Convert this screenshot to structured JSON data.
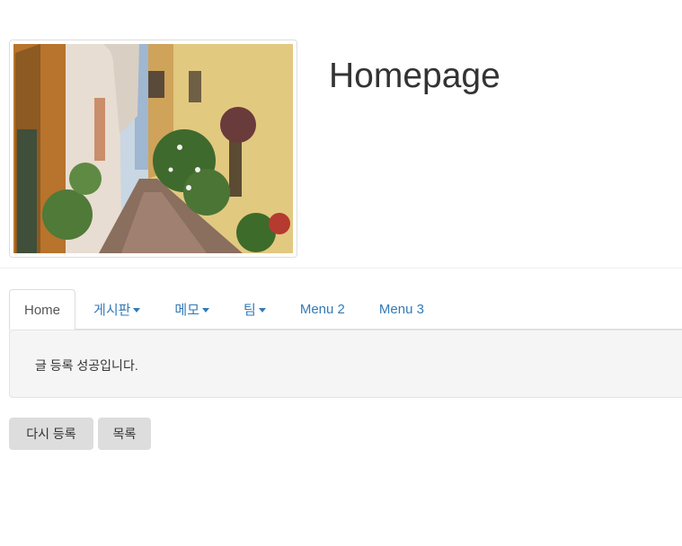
{
  "header": {
    "title": "Homepage"
  },
  "nav": {
    "tabs": [
      {
        "label": "Home",
        "active": true,
        "dropdown": false
      },
      {
        "label": "게시판",
        "active": false,
        "dropdown": true
      },
      {
        "label": "메모",
        "active": false,
        "dropdown": true
      },
      {
        "label": "팀",
        "active": false,
        "dropdown": true
      },
      {
        "label": "Menu 2",
        "active": false,
        "dropdown": false
      },
      {
        "label": "Menu 3",
        "active": false,
        "dropdown": false
      }
    ]
  },
  "message": {
    "text": "글 등록 성공입니다."
  },
  "actions": {
    "rewrite_label": "다시 등록",
    "list_label": "목록"
  },
  "colors": {
    "link": "#337ab7",
    "well_bg": "#f5f5f5",
    "button_bg": "#dddddd"
  }
}
